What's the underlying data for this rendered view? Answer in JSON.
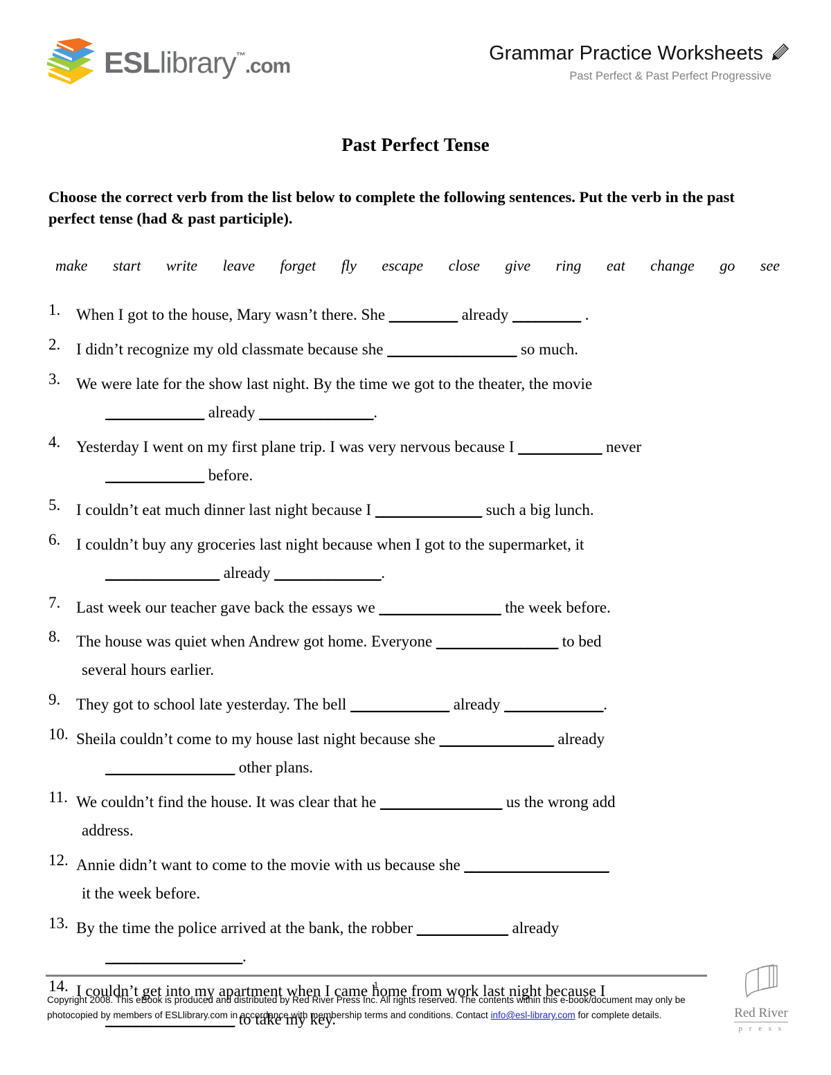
{
  "brand": {
    "logo_text_esl": "ESL",
    "logo_text_library": "library",
    "logo_tm": "™",
    "logo_com": ".com",
    "book_colors": [
      "#f07020",
      "#4a9dd8",
      "#9bcb3b",
      "#fbc015"
    ],
    "logo_gray": "#6d6e71"
  },
  "header": {
    "title": "Grammar Practice Worksheets",
    "subtitle": "Past Perfect & Past Perfect Progressive",
    "pencil_icon": "pencil-icon"
  },
  "document": {
    "title": "Past Perfect Tense",
    "instructions": "Choose the correct verb from the list below to complete the following sentences. Put the verb in the past perfect tense (had & past participle)."
  },
  "word_bank": [
    "make",
    "start",
    "write",
    "leave",
    "forget",
    "fly",
    "escape",
    "close",
    "give",
    "ring",
    "eat",
    "change",
    "go",
    "see"
  ],
  "questions": [
    {
      "number": "1.",
      "lines": [
        [
          {
            "t": "text",
            "v": "When I got to the house, Mary wasn’t there. She "
          },
          {
            "t": "blank",
            "v": "_________"
          },
          {
            "t": "text",
            "v": " already "
          },
          {
            "t": "blank",
            "v": "_________"
          },
          {
            "t": "text",
            "v": " ."
          }
        ]
      ]
    },
    {
      "number": "2.",
      "lines": [
        [
          {
            "t": "text",
            "v": "I didn’t recognize my old classmate because she "
          },
          {
            "t": "blank",
            "v": "_________________"
          },
          {
            "t": "text",
            "v": " so much."
          }
        ]
      ]
    },
    {
      "number": "3.",
      "lines": [
        [
          {
            "t": "text",
            "v": "We were late for the show last night. By the time we got to the theater, the movie"
          }
        ],
        [
          {
            "t": "indent",
            "v": ""
          },
          {
            "t": "blank",
            "v": "_____________"
          },
          {
            "t": "text",
            "v": " already "
          },
          {
            "t": "blank",
            "v": "_______________"
          },
          {
            "t": "text",
            "v": "."
          }
        ]
      ]
    },
    {
      "number": "4.",
      "lines": [
        [
          {
            "t": "text",
            "v": "Yesterday I went on my first plane trip. I was very nervous because I "
          },
          {
            "t": "blank",
            "v": "___________"
          },
          {
            "t": "text",
            "v": " never"
          }
        ],
        [
          {
            "t": "indent",
            "v": ""
          },
          {
            "t": "blank",
            "v": "_____________"
          },
          {
            "t": "text",
            "v": " before."
          }
        ]
      ]
    },
    {
      "number": "5.",
      "lines": [
        [
          {
            "t": "text",
            "v": "I couldn’t eat much dinner last night because I "
          },
          {
            "t": "blank",
            "v": "______________"
          },
          {
            "t": "text",
            "v": " such a big lunch."
          }
        ]
      ]
    },
    {
      "number": "6.",
      "lines": [
        [
          {
            "t": "text",
            "v": "I couldn’t buy any groceries last night because when I got to the supermarket, it"
          }
        ],
        [
          {
            "t": "indent",
            "v": ""
          },
          {
            "t": "blank",
            "v": "_______________"
          },
          {
            "t": "text",
            "v": " already "
          },
          {
            "t": "blank",
            "v": "______________"
          },
          {
            "t": "text",
            "v": "."
          }
        ]
      ]
    },
    {
      "number": "7.",
      "lines": [
        [
          {
            "t": "text",
            "v": "Last week our teacher gave back the essays we "
          },
          {
            "t": "blank",
            "v": "________________"
          },
          {
            "t": "text",
            "v": " the week before."
          }
        ]
      ]
    },
    {
      "number": "8.",
      "lines": [
        [
          {
            "t": "text",
            "v": "The house was quiet when Andrew got home. Everyone "
          },
          {
            "t": "blank",
            "v": "________________"
          },
          {
            "t": "text",
            "v": " to bed"
          }
        ],
        [
          {
            "t": "indent-sm",
            "v": ""
          },
          {
            "t": "text",
            "v": "several hours earlier."
          }
        ]
      ]
    },
    {
      "number": "9.",
      "lines": [
        [
          {
            "t": "text",
            "v": "They got to school late yesterday. The bell "
          },
          {
            "t": "blank",
            "v": "_____________"
          },
          {
            "t": "text",
            "v": " already "
          },
          {
            "t": "blank",
            "v": "_____________"
          },
          {
            "t": "text",
            "v": "."
          }
        ]
      ]
    },
    {
      "number": "10.",
      "lines": [
        [
          {
            "t": "text",
            "v": "Sheila couldn’t come to my house last night because she "
          },
          {
            "t": "blank",
            "v": "_______________"
          },
          {
            "t": "text",
            "v": " already"
          }
        ],
        [
          {
            "t": "indent",
            "v": ""
          },
          {
            "t": "blank",
            "v": "_________________"
          },
          {
            "t": "text",
            "v": " other plans."
          }
        ]
      ]
    },
    {
      "number": "11.",
      "lines": [
        [
          {
            "t": "text",
            "v": "We couldn’t find the house. It was clear that he "
          },
          {
            "t": "blank",
            "v": "________________"
          },
          {
            "t": "text",
            "v": " us the wrong add"
          }
        ],
        [
          {
            "t": "indent-sm",
            "v": ""
          },
          {
            "t": "text",
            "v": "address."
          }
        ]
      ]
    },
    {
      "number": "12.",
      "lines": [
        [
          {
            "t": "text",
            "v": "Annie didn’t want to come to the movie with us because she "
          },
          {
            "t": "blank",
            "v": "___________________"
          }
        ],
        [
          {
            "t": "indent-sm",
            "v": ""
          },
          {
            "t": "text",
            "v": "it the week before."
          }
        ]
      ]
    },
    {
      "number": "13.",
      "lines": [
        [
          {
            "t": "text",
            "v": "By the time the police arrived at the bank, the robber "
          },
          {
            "t": "blank",
            "v": "____________"
          },
          {
            "t": "text",
            "v": " already"
          }
        ],
        [
          {
            "t": "indent",
            "v": ""
          },
          {
            "t": "blank",
            "v": "__________________"
          },
          {
            "t": "text",
            "v": "."
          }
        ]
      ]
    },
    {
      "number": "14.",
      "lines": [
        [
          {
            "t": "text",
            "v": "I couldn’t get into my apartment when I came home from work last night because I"
          }
        ],
        [
          {
            "t": "indent",
            "v": ""
          },
          {
            "t": "blank",
            "v": "_________________"
          },
          {
            "t": "text",
            "v": " to take my key."
          }
        ]
      ]
    }
  ],
  "footer": {
    "page_number": "1",
    "copyright_part1": "Copyright 2008.  This eBook is produced and distributed by Red River Press Inc.  All rights reserved.  The contents within this e-book/document may only be photocopied by members of ESLlibrary.com in accordance with membership terms and conditions. Contact ",
    "email": "info@esl-library.com",
    "copyright_part2": " for complete details.",
    "email_color": "#2222cc"
  },
  "publisher_logo": {
    "name": "Red River",
    "press": "p r e s s",
    "color": "#808285"
  }
}
